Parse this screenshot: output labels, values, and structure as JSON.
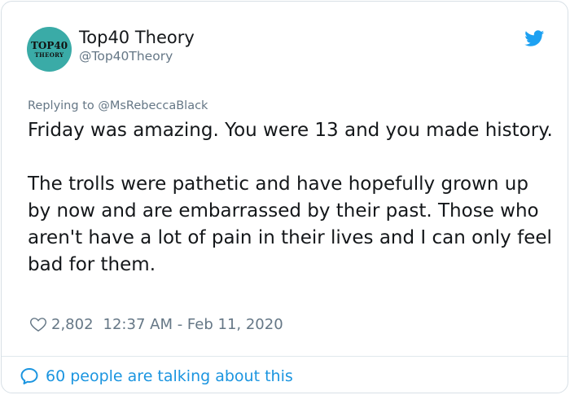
{
  "author": {
    "display_name": "Top40 Theory",
    "handle": "@Top40Theory",
    "avatar_line1": "TOP40",
    "avatar_line2": "THEORY"
  },
  "reply": {
    "replying_to": "Replying to @MsRebeccaBlack"
  },
  "tweet": {
    "text": "Friday was amazing. You were 13 and you made history.\n\nThe trolls were pathetic and have hopefully grown up by now and are embarrassed by their past. Those who aren't have a lot of pain in their lives and I can only feel bad for them.",
    "likes": "2,802",
    "timestamp": "12:37 AM - Feb 11, 2020"
  },
  "footer": {
    "talking": "60 people are talking about this"
  },
  "colors": {
    "twitter_blue": "#1da1f2",
    "avatar_teal": "#3aaba7",
    "muted_text": "#657786"
  }
}
